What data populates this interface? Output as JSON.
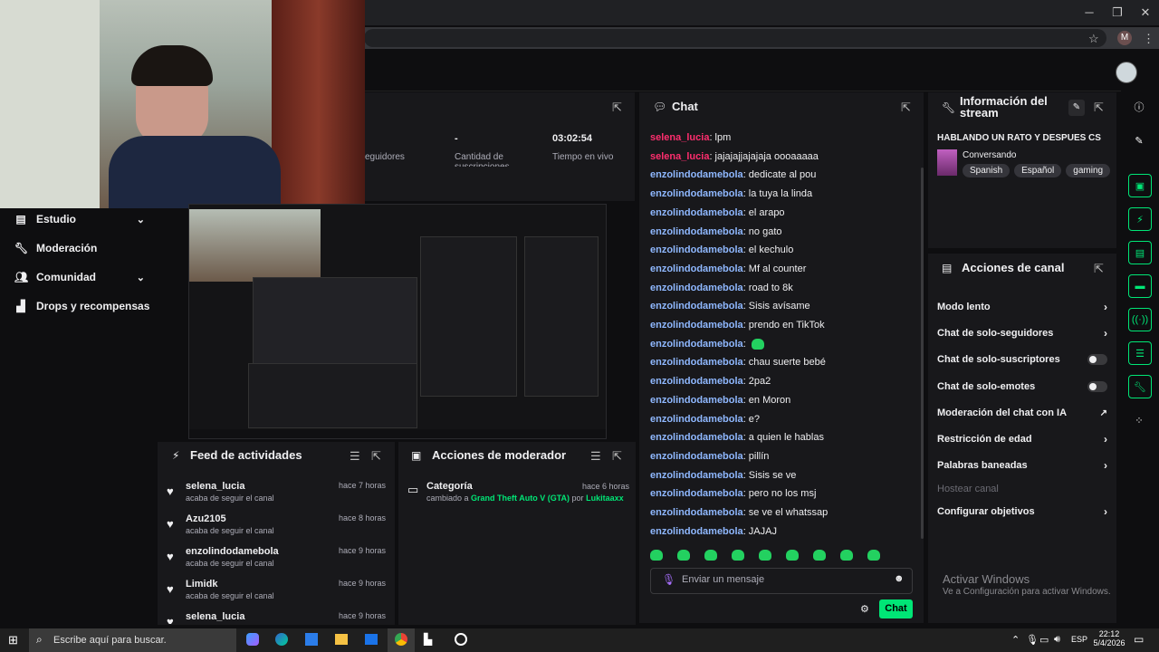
{
  "window": {
    "minimize": "─",
    "restore": "❐",
    "close": "✕",
    "avatar_initial": "M"
  },
  "stats": {
    "followers_label": "eguidores",
    "subs_value": "-",
    "subs_label": "Cantidad de suscripciones",
    "live_value": "03:02:54",
    "live_label": "Tiempo en vivo"
  },
  "nav": {
    "items": [
      {
        "label": "Estudio"
      },
      {
        "label": "Moderación"
      },
      {
        "label": "Comunidad"
      },
      {
        "label": "Drops y recompensas"
      }
    ]
  },
  "chat": {
    "title": "Chat",
    "messages": [
      {
        "user": "selena_lucia",
        "text": ": lpm",
        "red": true
      },
      {
        "user": "selena_lucia",
        "text": ": jajajajjajajaja oooaaaaa",
        "red": true
      },
      {
        "user": "enzolindodamebola",
        "text": ": dedicate al pou"
      },
      {
        "user": "enzolindodamebola",
        "text": ": la tuya la linda"
      },
      {
        "user": "enzolindodamebola",
        "text": ": el arapo"
      },
      {
        "user": "enzolindodamebola",
        "text": ": no gato"
      },
      {
        "user": "enzolindodamebola",
        "text": ": el kechulo"
      },
      {
        "user": "enzolindodamebola",
        "text": ": Mf al counter"
      },
      {
        "user": "enzolindodamebola",
        "text": ": road to 8k"
      },
      {
        "user": "enzolindodamebola",
        "text": ": Sisis avísame"
      },
      {
        "user": "enzolindodamebola",
        "text": ": prendo en TikTok"
      },
      {
        "user": "enzolindodamebola",
        "text": ":",
        "emote": true
      },
      {
        "user": "enzolindodamebola",
        "text": ": chau suerte bebé"
      },
      {
        "user": "enzolindodamebola",
        "text": ": 2pa2"
      },
      {
        "user": "enzolindodamebola",
        "text": ": en Moron"
      },
      {
        "user": "enzolindodamebola",
        "text": ": e?"
      },
      {
        "user": "enzolindodamebola",
        "text": ": a quien le hablas"
      },
      {
        "user": "enzolindodamebola",
        "text": ": pillín"
      },
      {
        "user": "enzolindodamebola",
        "text": ": Sisis se ve"
      },
      {
        "user": "enzolindodamebola",
        "text": ": pero no los msj"
      },
      {
        "user": "enzolindodamebola",
        "text": ": se ve el whatssap"
      },
      {
        "user": "enzolindodamebola",
        "text": ": JAJAJ"
      }
    ],
    "input_placeholder": "Enviar un mensaje",
    "send_label": "Chat"
  },
  "stream_info": {
    "title": "Información del stream",
    "stream_title": "HABLANDO UN RATO Y DESPUES CS",
    "category": "Conversando",
    "tags": [
      "Spanish",
      "Español",
      "gaming"
    ]
  },
  "channel_actions": {
    "title": "Acciones de canal",
    "items": [
      {
        "label": "Modo lento",
        "control": "chevron"
      },
      {
        "label": "Chat de solo-seguidores",
        "control": "chevron"
      },
      {
        "label": "Chat de solo-suscriptores",
        "control": "toggle"
      },
      {
        "label": "Chat de solo-emotes",
        "control": "toggle"
      },
      {
        "label": "Moderación del chat con IA",
        "control": "external"
      },
      {
        "label": "Restricción de edad",
        "control": "chevron"
      },
      {
        "label": "Palabras baneadas",
        "control": "chevron"
      },
      {
        "label": "Hostear canal",
        "control": "none",
        "disabled": true
      },
      {
        "label": "Configurar objetivos",
        "control": "chevron"
      }
    ]
  },
  "activation": {
    "title": "Activar Windows",
    "sub": "Ve a Configuración para activar Windows."
  },
  "feed": {
    "title": "Feed de actividades",
    "items": [
      {
        "user": "selena_lucia",
        "sub": "acaba de seguir el canal",
        "time": "hace 7 horas"
      },
      {
        "user": "Azu2105",
        "sub": "acaba de seguir el canal",
        "time": "hace 8 horas"
      },
      {
        "user": "enzolindodamebola",
        "sub": "acaba de seguir el canal",
        "time": "hace 9 horas"
      },
      {
        "user": "Limidk",
        "sub": "acaba de seguir el canal",
        "time": "hace 9 horas"
      },
      {
        "user": "selena_lucia",
        "sub": "",
        "time": "hace 9 horas"
      }
    ]
  },
  "mod_actions": {
    "title": "Acciones de moderador",
    "items": [
      {
        "type": "Categoría",
        "time": "hace 6 horas",
        "prefix": "cambiado a",
        "game": "Grand Theft Auto V (GTA)",
        "by": "por",
        "user": "Lukitaaxx"
      }
    ]
  },
  "taskbar": {
    "search_placeholder": "Escribe aquí para buscar.",
    "time": "22:12",
    "date": "5/4/2026",
    "lang": "ESP"
  }
}
